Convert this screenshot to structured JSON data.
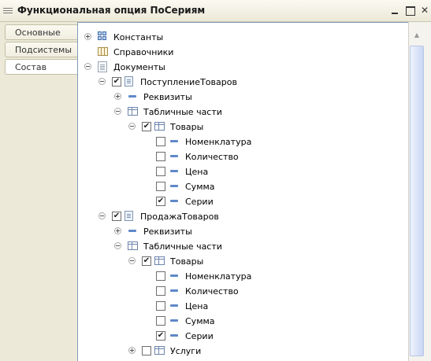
{
  "window": {
    "title": "Функциональная опция ПоСериям",
    "close_glyph": "✕"
  },
  "tabs": [
    {
      "label": "Основные",
      "active": false
    },
    {
      "label": "Подсистемы",
      "active": false
    },
    {
      "label": "Состав",
      "active": true
    }
  ],
  "tree": {
    "constants": {
      "label": "Константы",
      "expander": "plus",
      "icon": "constants-icon"
    },
    "catalogs": {
      "label": "Справочники",
      "icon": "catalog-icon"
    },
    "documents": {
      "label": "Документы",
      "expander": "minus",
      "icon": "documents-icon"
    },
    "doc1": {
      "label": "ПоступлениеТоваров",
      "checked": true,
      "expander": "minus",
      "attributes_label": "Реквизиты",
      "tabular_label": "Табличные части",
      "table": {
        "label": "Товары",
        "checked": true,
        "fields": [
          {
            "label": "Номенклатура",
            "checked": false
          },
          {
            "label": "Количество",
            "checked": false
          },
          {
            "label": "Цена",
            "checked": false
          },
          {
            "label": "Сумма",
            "checked": false
          },
          {
            "label": "Серии",
            "checked": true
          }
        ]
      }
    },
    "doc2": {
      "label": "ПродажаТоваров",
      "checked": true,
      "expander": "minus",
      "attributes_label": "Реквизиты",
      "tabular_label": "Табличные части",
      "table": {
        "label": "Товары",
        "checked": true,
        "fields": [
          {
            "label": "Номенклатура",
            "checked": false
          },
          {
            "label": "Количество",
            "checked": false
          },
          {
            "label": "Цена",
            "checked": false
          },
          {
            "label": "Сумма",
            "checked": false
          },
          {
            "label": "Серии",
            "checked": true
          }
        ]
      },
      "table2": {
        "label": "Услуги",
        "checked": false
      }
    },
    "check_glyph": "✔"
  }
}
